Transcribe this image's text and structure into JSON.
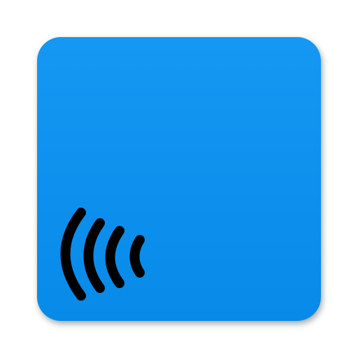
{
  "app_icon": {
    "icon": "wireless-signal-icon",
    "colors": {
      "background_top": "#1598f4",
      "background_bottom": "#078ae8",
      "glyph": "#000000",
      "page": "#ffffff"
    }
  }
}
